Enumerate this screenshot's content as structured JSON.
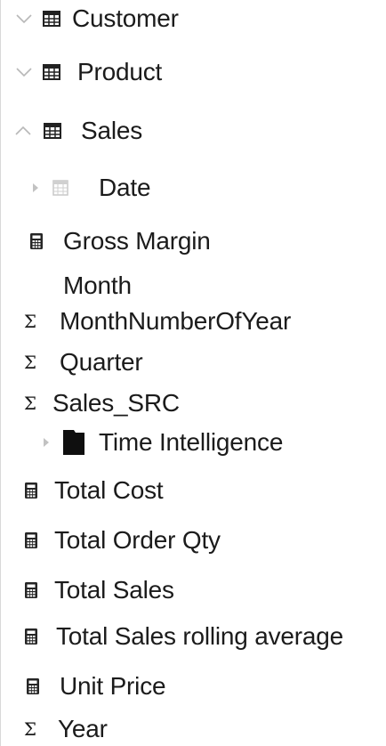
{
  "fields_pane": {
    "tables": [
      {
        "label": "Customer",
        "icon": "table-icon",
        "chevron": "chevron-down-icon"
      },
      {
        "label": "Product",
        "icon": "table-icon",
        "chevron": "chevron-down-icon"
      },
      {
        "label": "Sales",
        "icon": "table-icon",
        "chevron": "chevron-up-icon"
      }
    ],
    "sales_fields": [
      {
        "label": "Date",
        "icon": "calendar-icon",
        "expandable": true
      },
      {
        "label": "Gross Margin",
        "icon": "calculator-icon"
      },
      {
        "label": "Month",
        "icon": ""
      },
      {
        "label": "MonthNumberOfYear",
        "icon": "sigma-icon"
      },
      {
        "label": "Quarter",
        "icon": "sigma-icon"
      },
      {
        "label": "Sales_SRC",
        "icon": "sigma-icon"
      },
      {
        "label": "Time Intelligence",
        "icon": "folder-icon",
        "expandable": true
      },
      {
        "label": "Total Cost",
        "icon": "calculator-icon"
      },
      {
        "label": "Total Order Qty",
        "icon": "calculator-icon"
      },
      {
        "label": "Total Sales",
        "icon": "calculator-icon"
      },
      {
        "label": "Total Sales rolling average",
        "icon": "calculator-icon"
      },
      {
        "label": "Unit Price",
        "icon": "calculator-icon"
      },
      {
        "label": "Year",
        "icon": "sigma-icon"
      }
    ],
    "sigma_glyph": "Σ"
  }
}
